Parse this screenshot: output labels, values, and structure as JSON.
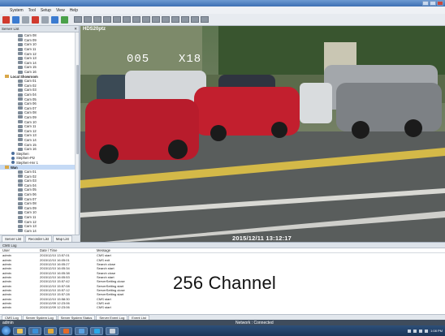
{
  "menu": [
    "System",
    "Tool",
    "Setup",
    "View",
    "Help"
  ],
  "sidebar": {
    "header": "Server List",
    "tree": [
      {
        "label": "Cam 08",
        "type": "cam"
      },
      {
        "label": "Cam 09",
        "type": "cam"
      },
      {
        "label": "Cam 10",
        "type": "cam"
      },
      {
        "label": "Cam 11",
        "type": "cam"
      },
      {
        "label": "Cam 12",
        "type": "cam"
      },
      {
        "label": "Cam 13",
        "type": "cam"
      },
      {
        "label": "Cam 14",
        "type": "cam"
      },
      {
        "label": "Cam 15",
        "type": "cam"
      },
      {
        "label": "Cam 16",
        "type": "cam"
      },
      {
        "label": "Local Showroom",
        "type": "group"
      },
      {
        "label": "Cam 01",
        "type": "cam"
      },
      {
        "label": "Cam 02",
        "type": "cam"
      },
      {
        "label": "Cam 03",
        "type": "cam"
      },
      {
        "label": "Cam 04",
        "type": "cam"
      },
      {
        "label": "Cam 05",
        "type": "cam"
      },
      {
        "label": "Cam 06",
        "type": "cam"
      },
      {
        "label": "Cam 07",
        "type": "cam"
      },
      {
        "label": "Cam 08",
        "type": "cam"
      },
      {
        "label": "Cam 09",
        "type": "cam"
      },
      {
        "label": "Cam 10",
        "type": "cam"
      },
      {
        "label": "Cam 11",
        "type": "cam"
      },
      {
        "label": "Cam 12",
        "type": "cam"
      },
      {
        "label": "Cam 13",
        "type": "cam"
      },
      {
        "label": "Cam 14",
        "type": "cam"
      },
      {
        "label": "Cam 15",
        "type": "cam"
      },
      {
        "label": "Cam 16",
        "type": "cam"
      },
      {
        "label": "Stephen",
        "type": "user"
      },
      {
        "label": "Stephen-Ptz",
        "type": "user"
      },
      {
        "label": "Stephen-Hvr 1",
        "type": "user"
      },
      {
        "label": "Wan",
        "type": "group",
        "selected": true
      },
      {
        "label": "Cam 01",
        "type": "cam"
      },
      {
        "label": "Cam 02",
        "type": "cam"
      },
      {
        "label": "Cam 03",
        "type": "cam"
      },
      {
        "label": "Cam 04",
        "type": "cam"
      },
      {
        "label": "Cam 05",
        "type": "cam"
      },
      {
        "label": "Cam 06",
        "type": "cam"
      },
      {
        "label": "Cam 07",
        "type": "cam"
      },
      {
        "label": "Cam 08",
        "type": "cam"
      },
      {
        "label": "Cam 09",
        "type": "cam"
      },
      {
        "label": "Cam 10",
        "type": "cam"
      },
      {
        "label": "Cam 11",
        "type": "cam"
      },
      {
        "label": "Cam 12",
        "type": "cam"
      },
      {
        "label": "Cam 13",
        "type": "cam"
      },
      {
        "label": "Cam 14",
        "type": "cam"
      }
    ],
    "tabs": [
      "Server List",
      "Recorder List",
      "Map List"
    ]
  },
  "video": {
    "camera_name": "HDS20ptz",
    "ptz_position": "005",
    "ptz_zoom": "X18",
    "timestamp": "2015/12/11 13:12:17"
  },
  "log": {
    "title": "CMS Log",
    "columns": [
      "User",
      "Date / Time",
      "Message"
    ],
    "rows": [
      [
        "admin",
        "2015/12/10 13:57:01",
        "CMS start"
      ],
      [
        "admin",
        "2015/12/10 16:05:01",
        "CMS exit"
      ],
      [
        "admin",
        "2015/12/10 16:05:27",
        "Search close"
      ],
      [
        "admin",
        "2015/12/10 16:05:34",
        "Search start"
      ],
      [
        "admin",
        "2015/12/10 16:05:38",
        "Search close"
      ],
      [
        "admin",
        "2015/12/10 16:05:53",
        "Search start"
      ],
      [
        "admin",
        "2015/12/10 15:57:42",
        "ServerSetting close"
      ],
      [
        "admin",
        "2015/12/10 15:57:08",
        "ServerSetting start"
      ],
      [
        "admin",
        "2015/12/10 15:57:12",
        "ServerSetting close"
      ],
      [
        "admin",
        "2015/12/10 15:57:28",
        "ServerSetting start"
      ],
      [
        "admin",
        "2015/12/10 15:58:30",
        "CMS start"
      ],
      [
        "admin",
        "2015/12/09 12:23:06",
        "CMS exit"
      ],
      [
        "admin",
        "2015/12/09 12:23:06",
        "CMS start"
      ]
    ],
    "caption": "256 Channel",
    "tabs": [
      "CMS Log",
      "Server System Log",
      "Server System Status",
      "Server Event Log",
      "Event List"
    ]
  },
  "status": {
    "user": "admin",
    "network": "Network : Connected"
  },
  "taskbar": {
    "clock": "1:08 PM"
  }
}
